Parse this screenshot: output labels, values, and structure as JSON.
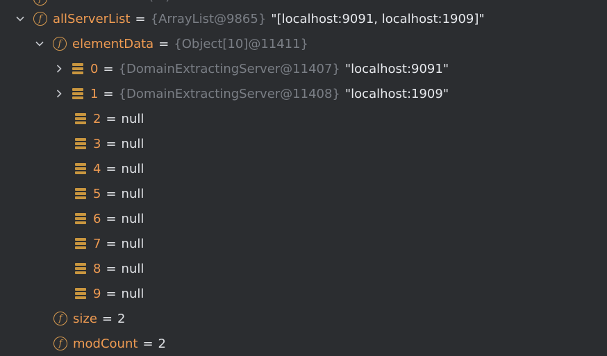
{
  "tree": {
    "clipped_row": {
      "name": "...",
      "type": "(...)"
    },
    "all_server_list": {
      "name": "allServerList",
      "type": "{ArrayList@9865}",
      "value": "\"[localhost:9091, localhost:1909]\""
    },
    "element_data": {
      "name": "elementData",
      "type": "{Object[10]@11411}"
    },
    "elements": [
      {
        "index": "0",
        "type": "{DomainExtractingServer@11407}",
        "value": "\"localhost:9091\"",
        "expandable": true
      },
      {
        "index": "1",
        "type": "{DomainExtractingServer@11408}",
        "value": "\"localhost:1909\"",
        "expandable": true
      },
      {
        "index": "2",
        "value": "null",
        "expandable": false
      },
      {
        "index": "3",
        "value": "null",
        "expandable": false
      },
      {
        "index": "4",
        "value": "null",
        "expandable": false
      },
      {
        "index": "5",
        "value": "null",
        "expandable": false
      },
      {
        "index": "6",
        "value": "null",
        "expandable": false
      },
      {
        "index": "7",
        "value": "null",
        "expandable": false
      },
      {
        "index": "8",
        "value": "null",
        "expandable": false
      },
      {
        "index": "9",
        "value": "null",
        "expandable": false
      }
    ],
    "size": {
      "name": "size",
      "value": "2"
    },
    "mod_count": {
      "name": "modCount",
      "value": "2"
    },
    "equals_sign": "=",
    "field_icon_glyph": "f"
  },
  "colors": {
    "background": "#2b2d30",
    "field_name": "#ef9b52",
    "type_text": "#7a7e85",
    "value_text": "#e6e8ec",
    "icon": "#d79a4f"
  },
  "icons": {
    "expand_open": "chevron-down-icon",
    "expand_closed": "chevron-right-icon",
    "field": "field-icon",
    "array_element": "array-element-icon"
  }
}
